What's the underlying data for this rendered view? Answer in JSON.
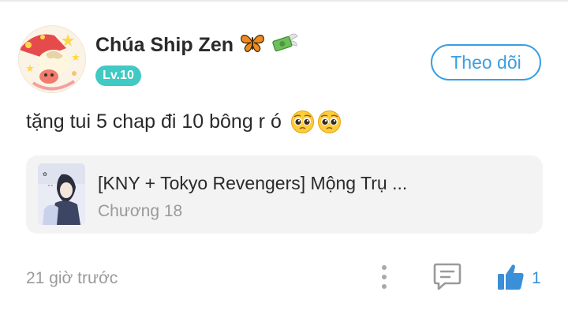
{
  "comment": {
    "user": {
      "name": "Chúa Ship Zen",
      "name_decorations": [
        "butterfly-icon",
        "money-with-wings-icon"
      ],
      "level": "Lv.10"
    },
    "follow_label": "Theo dõi",
    "text": "tặng tui 5 chap đi 10 bông r ó",
    "text_emojis": [
      "pleading-face-icon",
      "pleading-face-icon"
    ],
    "story": {
      "title": "[KNY + Tokyo Revengers] Mộng Trụ ...",
      "chapter": "Chương 18"
    },
    "timestamp": "21 giờ trước",
    "like_count": "1"
  },
  "colors": {
    "accent": "#3a9fe0",
    "level_badge": "#41c9c3",
    "like": "#3a8fd8",
    "muted_text": "#9a9a9a",
    "card_bg": "#f3f3f3"
  }
}
